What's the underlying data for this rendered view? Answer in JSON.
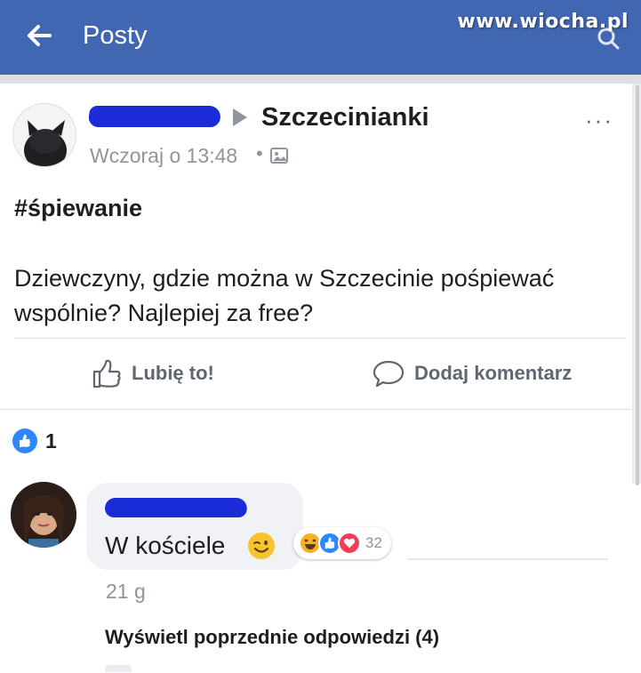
{
  "header": {
    "title": "Posty",
    "back_icon": "back-arrow-icon",
    "search_icon": "search-icon",
    "background": "#4267b2"
  },
  "watermark": "www.wiocha.pl",
  "post": {
    "group_name": "Szczecinianki",
    "timestamp": "Wczoraj o 13:48",
    "separator": "•",
    "hashtag": "#śpiewanie",
    "body": "Dziewczyny, gdzie można w Szczecinie pośpiewać wspólnie? Najlepiej za free?",
    "more_label": "···",
    "actions": {
      "like_label": "Lubię to!",
      "comment_label": "Dodaj komentarz"
    },
    "like_count": "1"
  },
  "comment": {
    "text": "W kościele",
    "emoji": "winking-face",
    "reaction_count": "32",
    "reactions": [
      "haha",
      "like",
      "love"
    ],
    "time": "21 g",
    "view_replies": "Wyświetl poprzednie odpowiedzi (4)"
  },
  "colors": {
    "accent": "#4267b2",
    "like_blue": "#2d88ff",
    "love_red": "#f33e58",
    "haha_yellow": "#f7b125",
    "redaction": "#1a2bd8",
    "muted_text": "#90949c"
  }
}
